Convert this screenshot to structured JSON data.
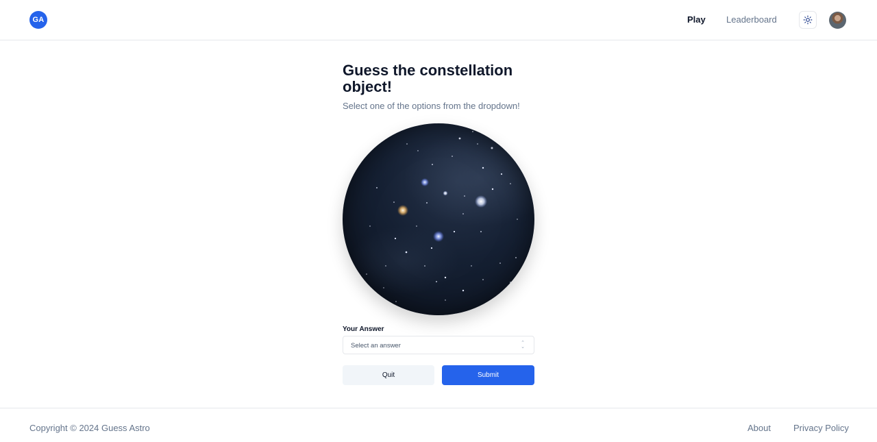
{
  "header": {
    "logo_text": "GA",
    "nav": {
      "play": "Play",
      "leaderboard": "Leaderboard"
    },
    "theme_icon": "sun-icon",
    "avatar_icon": "user-avatar"
  },
  "main": {
    "title": "Guess the constellation object!",
    "subtitle": "Select one of the options from the dropdown!",
    "answer_label": "Your Answer",
    "select": {
      "placeholder": "Select an answer",
      "icon": "chevron-up-down-icon"
    },
    "buttons": {
      "quit": "Quit",
      "submit": "Submit"
    }
  },
  "footer": {
    "copyright": "Copyright © 2024 Guess Astro",
    "links": {
      "about": "About",
      "privacy": "Privacy Policy"
    }
  },
  "colors": {
    "accent": "#2563eb",
    "text_primary": "#0f172a",
    "text_muted": "#64748b",
    "border": "#e5e7eb",
    "quit_bg": "#f1f5f9"
  }
}
